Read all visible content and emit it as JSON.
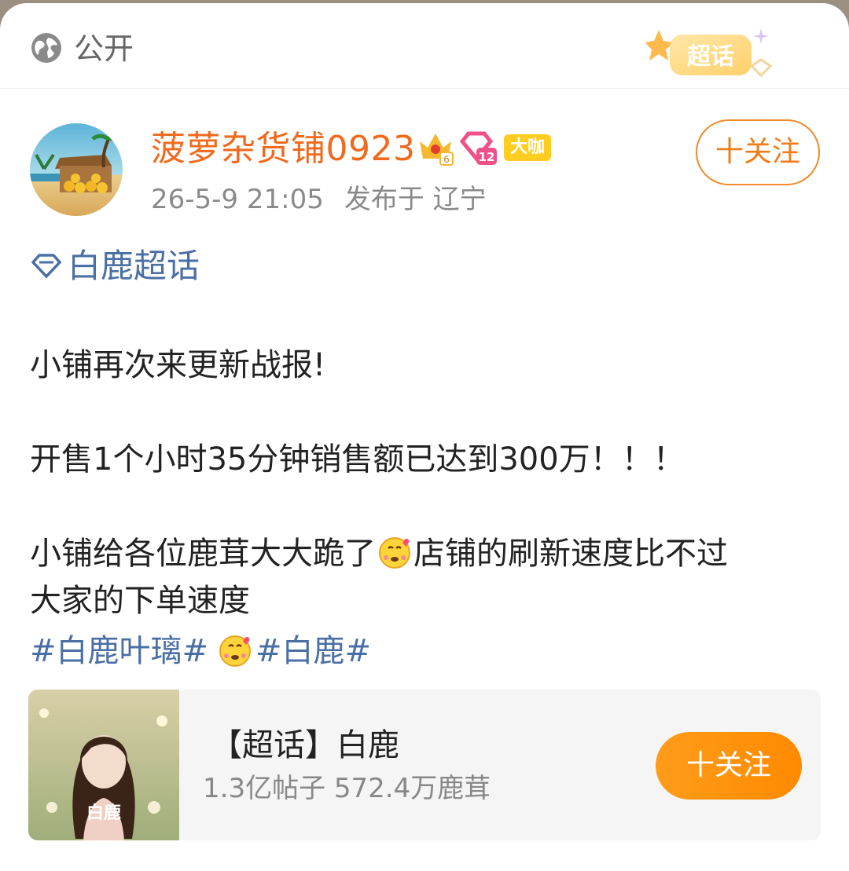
{
  "visibility": {
    "label": "公开",
    "icon": "globe-icon"
  },
  "badge": {
    "text": "超话",
    "icon": "star-badge-icon"
  },
  "author": {
    "name": "菠萝杂货铺0923",
    "crown_level": "6",
    "gem_level": "12",
    "tag": "大咖",
    "date": "26-5-9 21:05",
    "location": "发布于 辽宁",
    "follow_label": "十关注"
  },
  "post": {
    "topic": "白鹿超话",
    "line1": "小铺再次来更新战报!",
    "line2": "开售1个小时35分钟销售额已达到300万！！！",
    "line3a": "小铺给各位鹿茸大大跪了",
    "line3b": "店铺的刷新速度比不过",
    "line4": "大家的下单速度",
    "hashtag1": "#白鹿叶璃#",
    "hashtag2": "#白鹿#"
  },
  "card": {
    "title": "【超话】白鹿",
    "stats": "1.3亿帖子 572.4万鹿茸",
    "cover_text": "白鹿",
    "follow_label": "十关注"
  },
  "colors": {
    "orange": "#f06a1d",
    "link_blue": "#4a6fa5",
    "follow_gradient_start": "#ff9c1a",
    "follow_gradient_end": "#ff8a00"
  }
}
